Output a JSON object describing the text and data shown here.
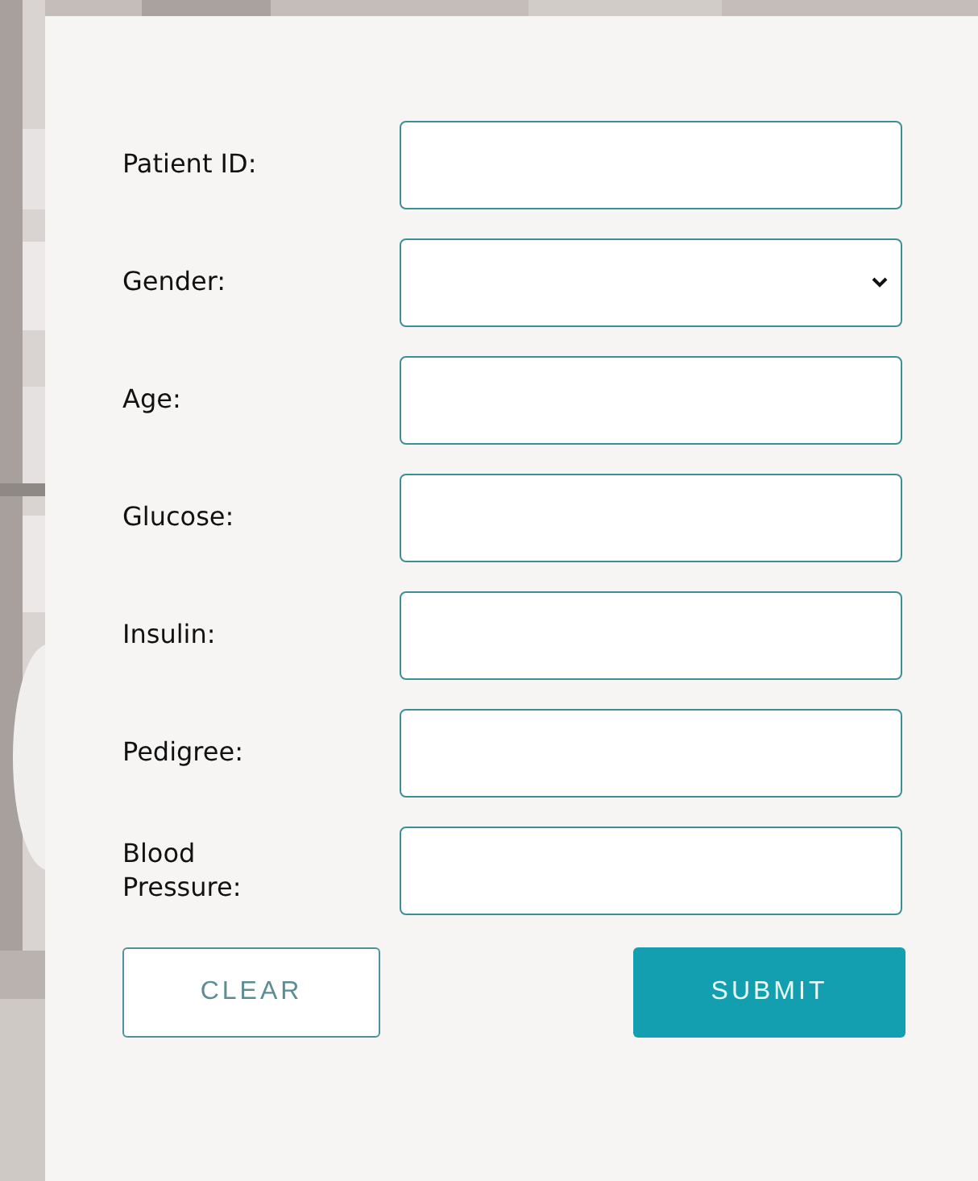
{
  "form": {
    "fields": [
      {
        "label": "Patient ID:",
        "kind": "text"
      },
      {
        "label": "Gender:",
        "kind": "select"
      },
      {
        "label": "Age:",
        "kind": "text"
      },
      {
        "label": "Glucose:",
        "kind": "text"
      },
      {
        "label": "Insulin:",
        "kind": "text"
      },
      {
        "label": "Pedigree:",
        "kind": "text"
      },
      {
        "label": "Blood Pressure:",
        "kind": "text"
      }
    ],
    "buttons": [
      {
        "label": "CLEAR",
        "kind": "outline"
      },
      {
        "label": "SUBMIT",
        "kind": "primary"
      }
    ]
  }
}
